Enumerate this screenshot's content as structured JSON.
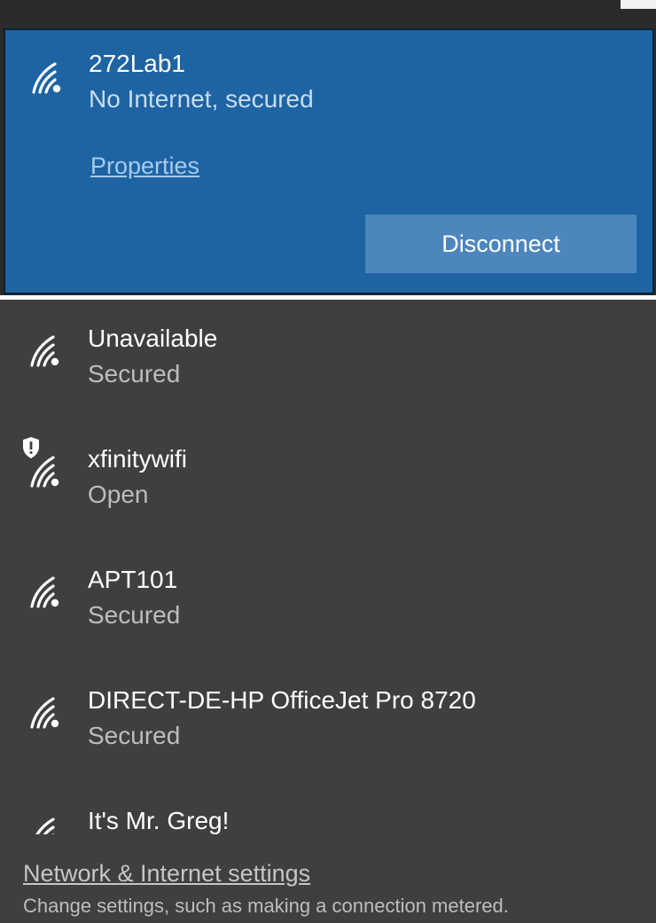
{
  "connected_network": {
    "name": "272Lab1",
    "status": "No Internet, secured",
    "properties_label": "Properties",
    "disconnect_label": "Disconnect",
    "icon": "wifi-signal-icon"
  },
  "networks": [
    {
      "name": "Unavailable",
      "status": "Secured",
      "icon": "wifi-signal-icon"
    },
    {
      "name": "xfinitywifi",
      "status": "Open",
      "icon": "wifi-open-warning-icon"
    },
    {
      "name": "APT101",
      "status": "Secured",
      "icon": "wifi-signal-icon"
    },
    {
      "name": "DIRECT-DE-HP OfficeJet Pro 8720",
      "status": "Secured",
      "icon": "wifi-signal-icon"
    },
    {
      "name": "It's Mr. Greg!",
      "status": "",
      "icon": "wifi-signal-icon"
    }
  ],
  "footer": {
    "settings_link": "Network & Internet settings",
    "settings_description": "Change settings, such as making a connection metered."
  },
  "colors": {
    "selected_background": "#1e64a3",
    "list_background": "#3f3f3f",
    "button_background": "#4d86bd"
  }
}
